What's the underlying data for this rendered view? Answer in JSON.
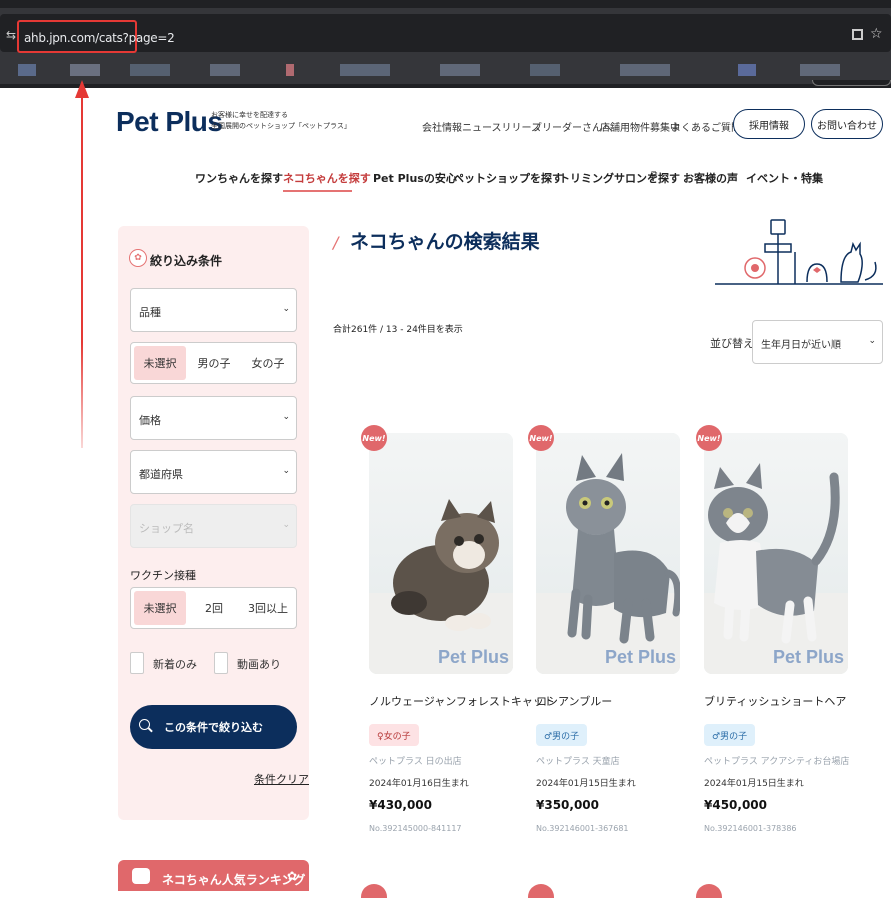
{
  "browser": {
    "url": "ahb.jpn.com/cats?page=2"
  },
  "header": {
    "logo": "Pet Plus",
    "tagline_line1": "お客様に幸せを配達する",
    "tagline_line2": "全国展開のペットショップ「ペットプラス」",
    "links": [
      "会社情報",
      "ニュースリリース",
      "ブリーダーさんへ",
      "店舗用物件募集中",
      "よくあるご質問"
    ],
    "recruit_button": "採用情報",
    "contact_button": "お問い合わせ"
  },
  "nav": {
    "items": [
      "ワンちゃんを探す",
      "ネコちゃんを探す",
      "Pet Plusの安心",
      "ペットショップを探す",
      "トリミングサロンを探す",
      "お客様の声",
      "イベント・特集"
    ],
    "active_index": 1
  },
  "sidebar": {
    "title": "絞り込み条件",
    "breed_select": "品種",
    "gender_options": [
      "未選択",
      "男の子",
      "女の子"
    ],
    "price_select": "価格",
    "prefecture_select": "都道府県",
    "shop_select": "ショップ名",
    "vaccine_label": "ワクチン接種",
    "vaccine_options": [
      "未選択",
      "2回",
      "3回以上"
    ],
    "new_only_label": "新着のみ",
    "video_label": "動画あり",
    "search_button": "この条件で絞り込む",
    "clear_link": "条件クリア",
    "ranking_label": "ネコちゃん人気ランキング"
  },
  "main": {
    "title": "ネコちゃんの検索結果",
    "result_count": "合計261件 / 13 - 24件目を表示",
    "sort_label": "並び替え",
    "sort_value": "生年月日が近い順",
    "new_badge": "New!",
    "watermark": "Pet Plus",
    "cards": [
      {
        "breed": "ノルウェージャンフォレストキャット",
        "gender": "♀女の子",
        "shop": "ペットプラス 日の出店",
        "birth": "2024年01月16日生まれ",
        "price": "¥430,000",
        "no": "No.392145000-841117"
      },
      {
        "breed": "ロシアンブルー",
        "gender": "♂男の子",
        "shop": "ペットプラス 天童店",
        "birth": "2024年01月15日生まれ",
        "price": "¥350,000",
        "no": "No.392146001-367681"
      },
      {
        "breed": "ブリティッシュショートヘア",
        "gender": "♂男の子",
        "shop": "ペットプラス アクアシティお台場店",
        "birth": "2024年01月15日生まれ",
        "price": "¥450,000",
        "no": "No.392146001-378386"
      }
    ]
  },
  "colors": {
    "navy": "#0c2e5c",
    "accent_red": "#e0686b",
    "sidebar_bg": "#fdeeee",
    "annotation_red": "#e53935"
  }
}
